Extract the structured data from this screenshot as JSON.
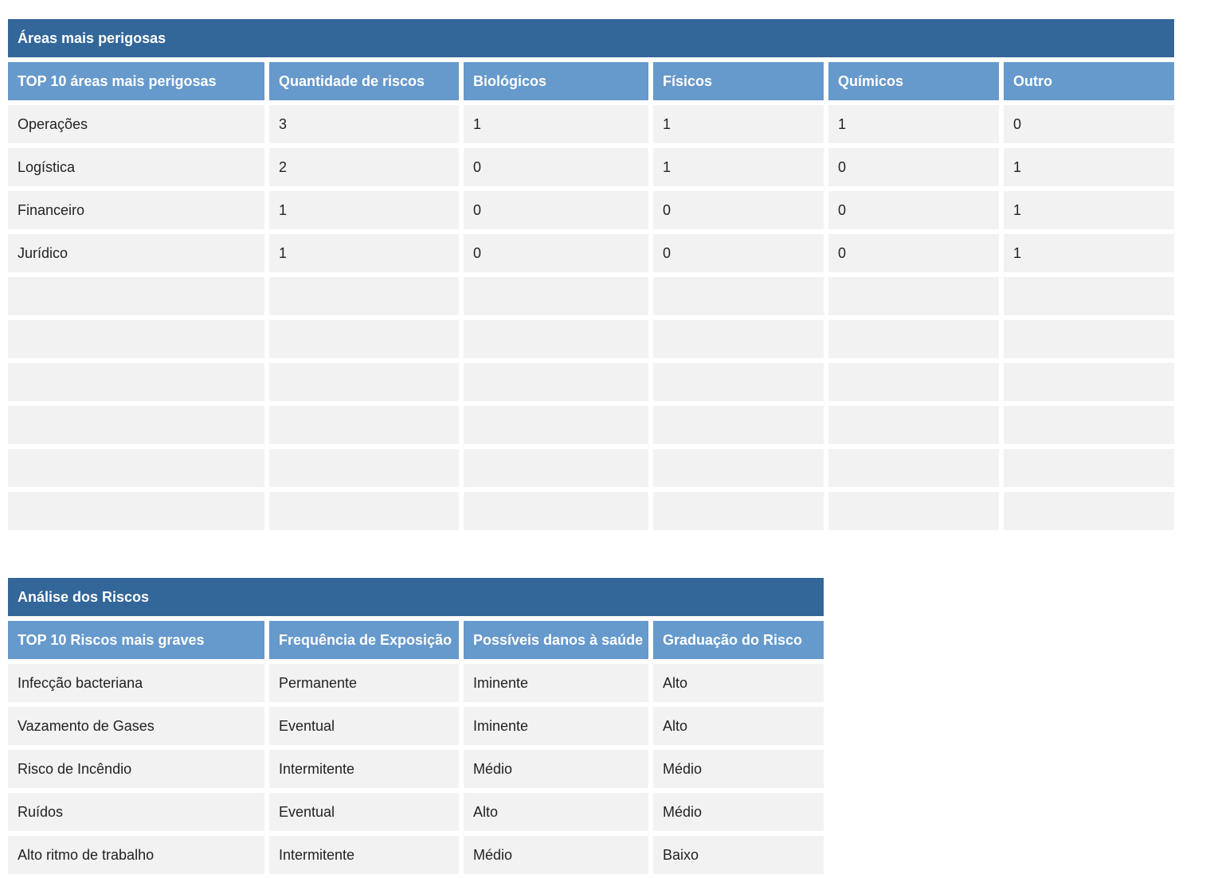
{
  "areas": {
    "title": "Áreas mais perigosas",
    "headers": [
      "TOP 10 áreas mais perigosas",
      "Quantidade de riscos",
      "Biológicos",
      "Físicos",
      "Químicos",
      "Outro"
    ],
    "rows": [
      [
        "Operações",
        "3",
        "1",
        "1",
        "1",
        "0"
      ],
      [
        "Logística",
        "2",
        "0",
        "1",
        "0",
        "1"
      ],
      [
        "Financeiro",
        "1",
        "0",
        "0",
        "0",
        "1"
      ],
      [
        "Jurídico",
        "1",
        "0",
        "0",
        "0",
        "1"
      ],
      [
        "",
        "",
        "",
        "",
        "",
        ""
      ],
      [
        "",
        "",
        "",
        "",
        "",
        ""
      ],
      [
        "",
        "",
        "",
        "",
        "",
        ""
      ],
      [
        "",
        "",
        "",
        "",
        "",
        ""
      ],
      [
        "",
        "",
        "",
        "",
        "",
        ""
      ],
      [
        "",
        "",
        "",
        "",
        "",
        ""
      ]
    ]
  },
  "riscos": {
    "title": "Análise dos Riscos",
    "headers": [
      "TOP 10 Riscos mais graves",
      "Frequência de Exposição",
      "Possíveis danos à saúde",
      "Graduação do Risco"
    ],
    "rows": [
      [
        "Infecção bacteriana",
        "Permanente",
        "Iminente",
        "Alto"
      ],
      [
        "Vazamento de Gases",
        "Eventual",
        "Iminente",
        "Alto"
      ],
      [
        "Risco de Incêndio",
        "Intermitente",
        "Médio",
        "Médio"
      ],
      [
        "Ruídos",
        "Eventual",
        "Alto",
        "Médio"
      ],
      [
        "Alto ritmo de trabalho",
        "Intermitente",
        "Médio",
        "Baixo"
      ]
    ]
  }
}
